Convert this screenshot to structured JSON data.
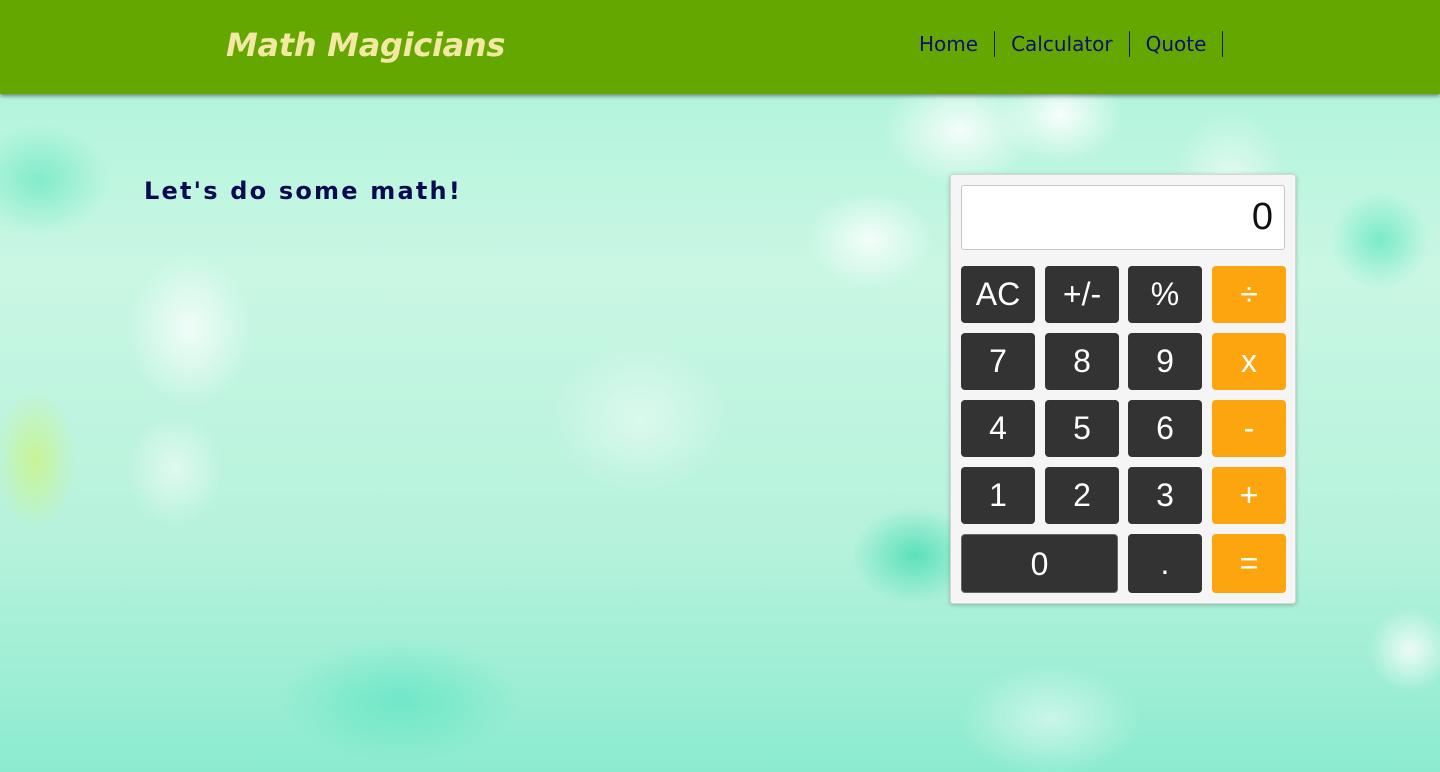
{
  "header": {
    "logo": "Math Magicians",
    "nav": [
      {
        "label": "Home"
      },
      {
        "label": "Calculator"
      },
      {
        "label": "Quote"
      }
    ]
  },
  "main": {
    "tagline": "Let's do some math!"
  },
  "calculator": {
    "display": "0",
    "keys": {
      "ac": "AC",
      "sign": "+/-",
      "percent": "%",
      "divide": "÷",
      "seven": "7",
      "eight": "8",
      "nine": "9",
      "multiply": "x",
      "four": "4",
      "five": "5",
      "six": "6",
      "subtract": "-",
      "one": "1",
      "two": "2",
      "three": "3",
      "add": "+",
      "zero": "0",
      "decimal": ".",
      "equals": "="
    },
    "colors": {
      "number_key": "#333333",
      "operator_key": "#fda50f"
    }
  },
  "colors": {
    "navbar": "#64a701",
    "logo": "#f4e9a4",
    "nav_link": "#101070",
    "tagline": "#0a0a50"
  }
}
